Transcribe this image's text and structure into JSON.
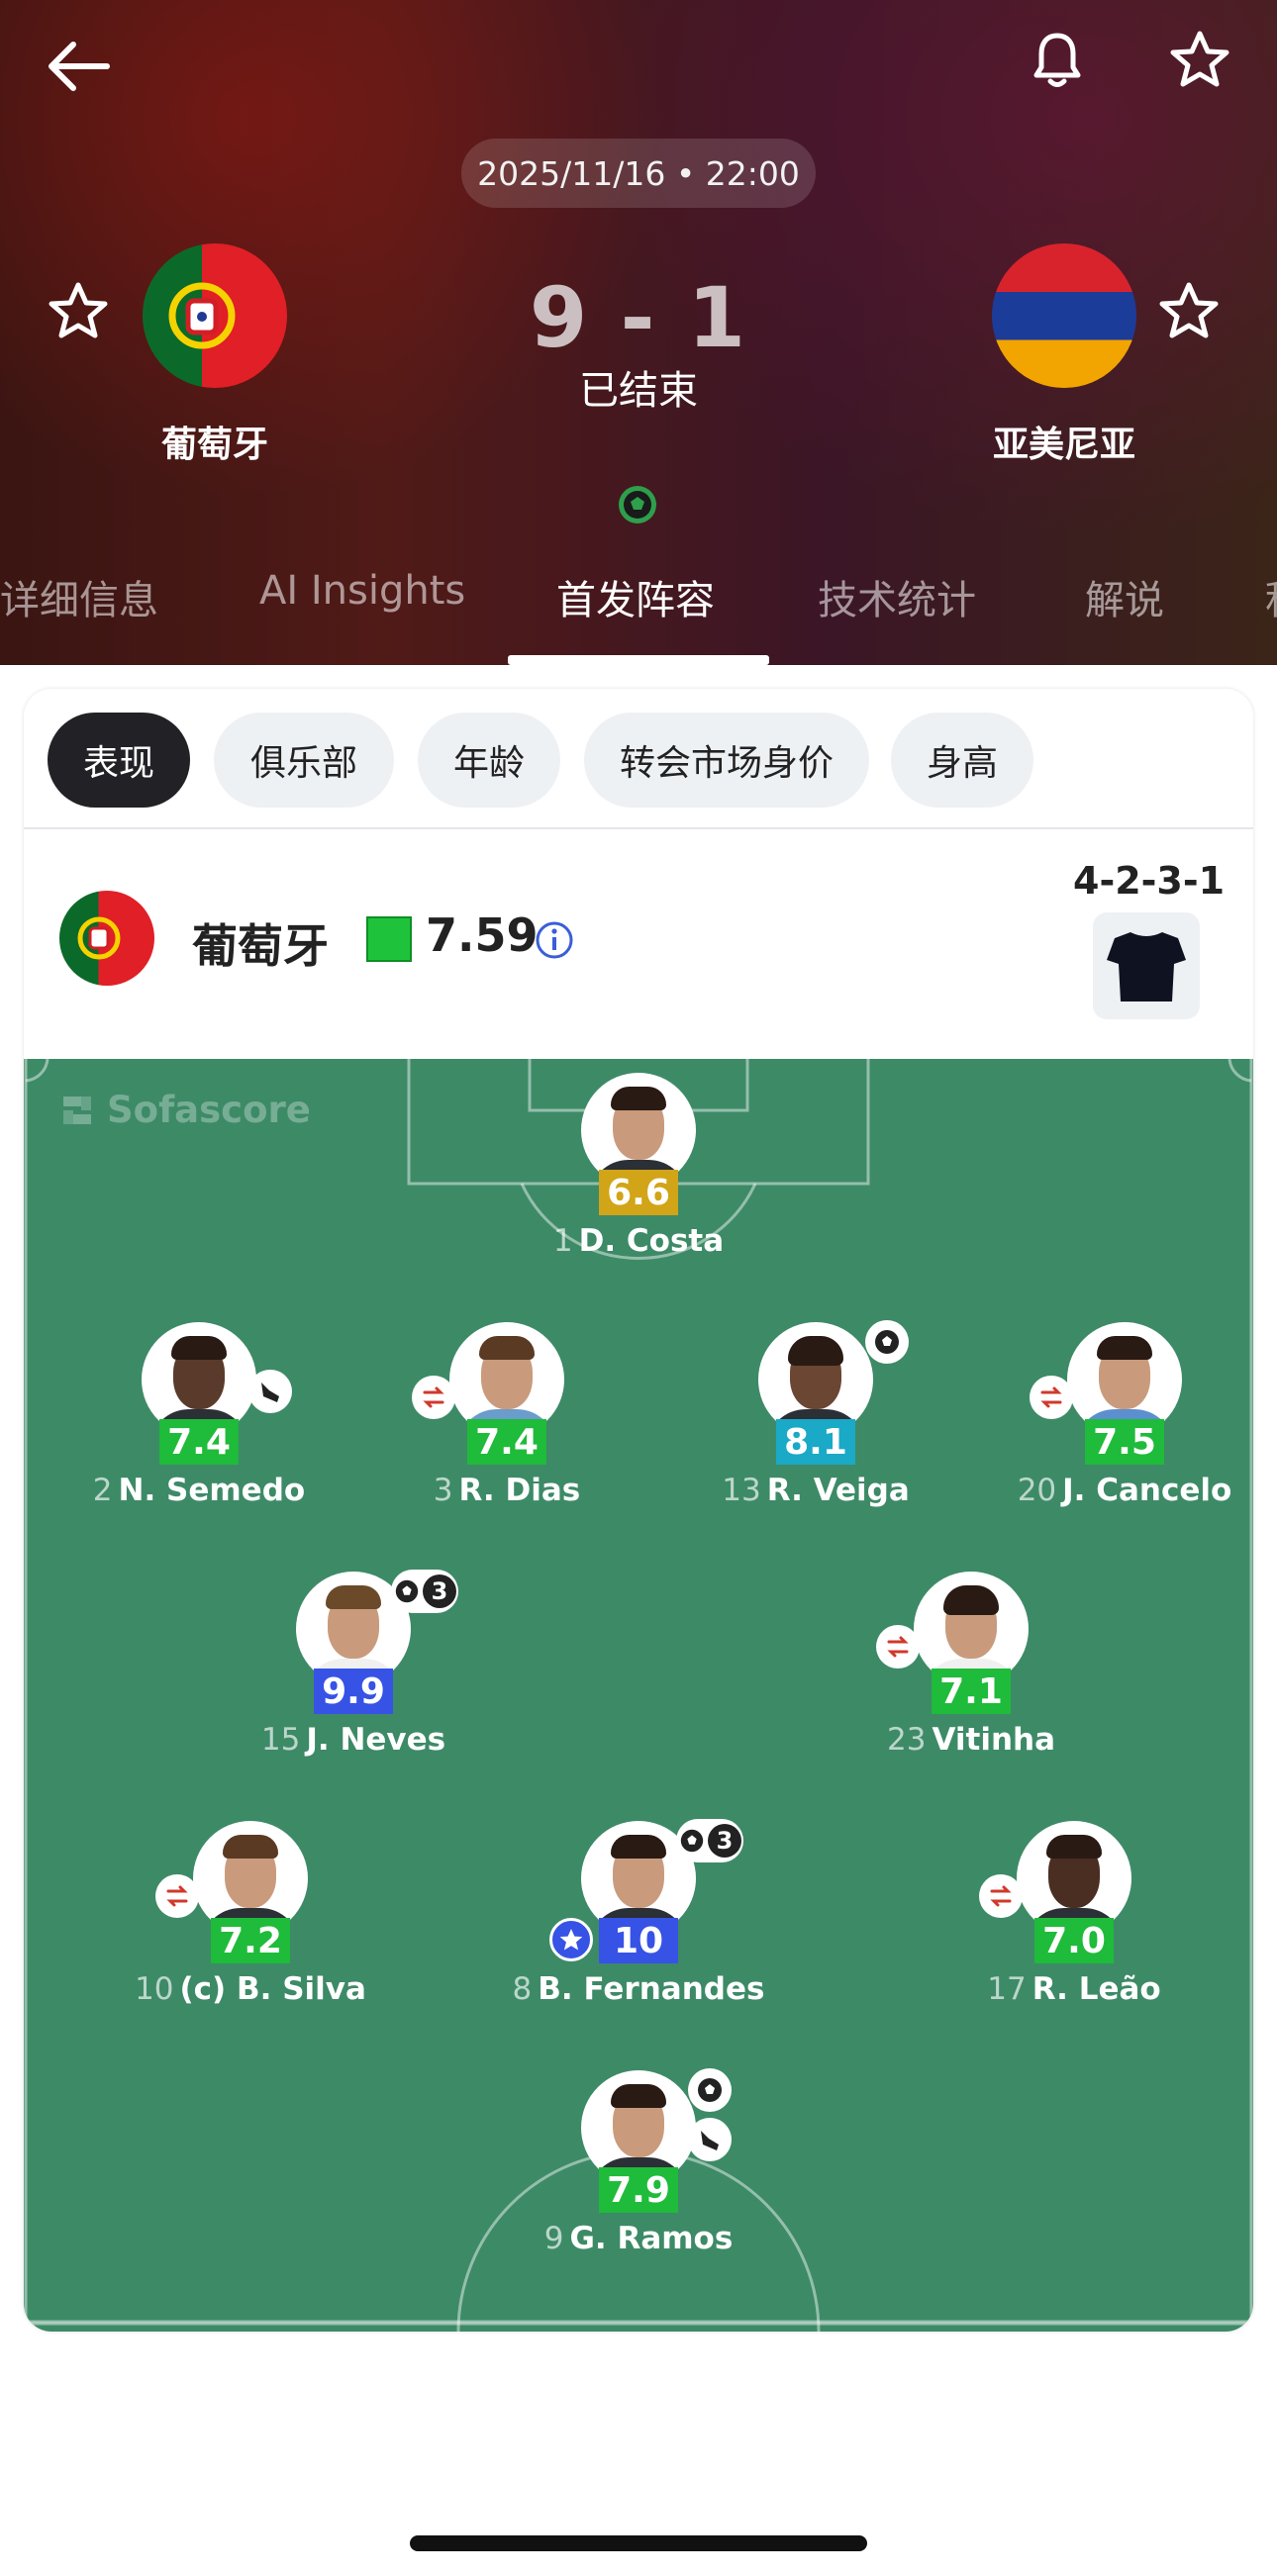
{
  "header": {
    "datetime": "2025/11/16 • 22:00",
    "home_team": "葡萄牙",
    "away_team": "亚美尼亚",
    "score": "9 - 1",
    "status": "已结束",
    "tabs": [
      "详细信息",
      "AI Insights",
      "首发阵容",
      "技术统计",
      "解说",
      "积"
    ],
    "active_tab": "首发阵容"
  },
  "filters": {
    "chips": [
      "表现",
      "俱乐部",
      "年龄",
      "转会市场身价",
      "身高"
    ],
    "active": "表现"
  },
  "lineup": {
    "team": "葡萄牙",
    "team_rating": "7.59",
    "formation": "4-2-3-1",
    "watermark": "Sofascore",
    "rating_colors": {
      "green": "#1fbb3a",
      "teal": "#1aa9c6",
      "blue": "#3653e6",
      "gold": "#d2a417"
    },
    "players": [
      {
        "num": "1",
        "name": "D. Costa",
        "rating": "6.6",
        "color": "#d2a417"
      },
      {
        "num": "2",
        "name": "N. Semedo",
        "rating": "7.4",
        "color": "#1fbb3a"
      },
      {
        "num": "3",
        "name": "R. Dias",
        "rating": "7.4",
        "color": "#1fbb3a"
      },
      {
        "num": "13",
        "name": "R. Veiga",
        "rating": "8.1",
        "color": "#1aa9c6"
      },
      {
        "num": "20",
        "name": "J. Cancelo",
        "rating": "7.5",
        "color": "#1fbb3a"
      },
      {
        "num": "15",
        "name": "J. Neves",
        "rating": "9.9",
        "color": "#3653e6",
        "goals": "3"
      },
      {
        "num": "23",
        "name": "Vitinha",
        "rating": "7.1",
        "color": "#1fbb3a"
      },
      {
        "num": "10",
        "name": "(c) B. Silva",
        "rating": "7.2",
        "color": "#1fbb3a"
      },
      {
        "num": "8",
        "name": "B. Fernandes",
        "rating": "10",
        "color": "#3653e6",
        "goals": "3"
      },
      {
        "num": "17",
        "name": "R. Leão",
        "rating": "7.0",
        "color": "#1fbb3a"
      },
      {
        "num": "9",
        "name": "G. Ramos",
        "rating": "7.9",
        "color": "#1fbb3a"
      }
    ]
  }
}
